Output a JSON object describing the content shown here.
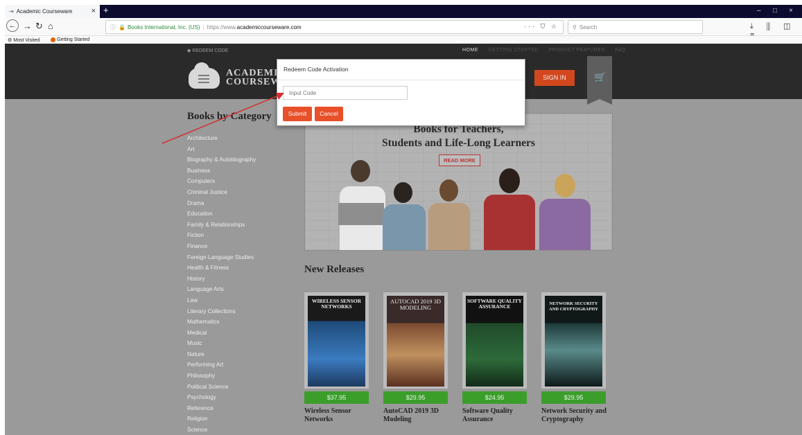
{
  "browser": {
    "tab_title": "Academic Courseware",
    "tab_close": "×",
    "new_tab": "+",
    "win_min": "–",
    "win_max": "□",
    "win_close": "×",
    "url_org": "Books International, Inc. (US)",
    "url_scheme": "https://www.",
    "url_host": "academiccourseware.com",
    "url_icons": "··· ⛉ ☆",
    "search_placeholder": "Search",
    "bookmarks": [
      "Most Visited",
      "Getting Started"
    ]
  },
  "site": {
    "redeem_link": "REDEEM CODE",
    "topnav": {
      "home": "HOME",
      "items": [
        "GETTING STARTED",
        "PRODUCT FEATURES",
        "FAQ"
      ]
    },
    "logo_line1": "ACADEMIC",
    "logo_line2": "COURSEWARE",
    "sign_in": "SIGN IN"
  },
  "sidebar": {
    "title": "Books by Category",
    "categories": [
      "Architecture",
      "Art",
      "Biography & Autobiography",
      "Business",
      "Computers",
      "Criminal Justice",
      "Drama",
      "Education",
      "Family & Relationships",
      "Fiction",
      "Finance",
      "Foreign Language Studies",
      "Health & Fitness",
      "History",
      "Language Arts",
      "Law",
      "Literary Collections",
      "Mathematics",
      "Medical",
      "Music",
      "Nature",
      "Performing Art",
      "Philosophy",
      "Political Science",
      "Psychology",
      "Reference",
      "Religion",
      "Science"
    ]
  },
  "hero": {
    "title_line1": "Books for Teachers,",
    "title_line2": "Students and Life-Long Learners",
    "read_more": "READ MORE"
  },
  "new_releases": {
    "title": "New Releases",
    "books": [
      {
        "cover_title": "WIRELESS SENSOR NETWORKS",
        "price": "$37.95",
        "title": "Wireless Sensor Networks"
      },
      {
        "cover_title": "AUTOCAD 2019 3D MODELING",
        "price": "$29.95",
        "title": "AutoCAD 2019 3D Modeling"
      },
      {
        "cover_title": "SOFTWARE QUALITY ASSURANCE",
        "price": "$24.95",
        "title": "Software Quality Assurance"
      },
      {
        "cover_title": "NETWORK SECURITY AND CRYPTOGRAPHY",
        "price": "$29.95",
        "title": "Network Security and Cryptography"
      }
    ]
  },
  "modal": {
    "title": "Redeem Code Activation",
    "input_placeholder": "Input Code",
    "submit": "Submit",
    "cancel": "Cancel"
  },
  "colors": {
    "accent": "#e8502a",
    "price_green": "#3b9e2b",
    "arrow": "#d32f2f"
  }
}
